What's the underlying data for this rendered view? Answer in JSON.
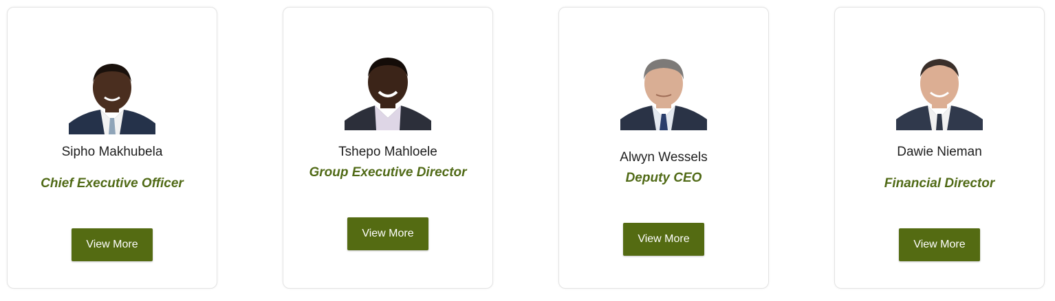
{
  "team": [
    {
      "name": "Sipho Makhubela",
      "role": "Chief Executive Officer",
      "button_label": "View More",
      "skin": "#4a2e1f",
      "suit": "#25324a",
      "shirt": "#f2f2f2",
      "tie": "#8fa4b8"
    },
    {
      "name": "Tshepo Mahloele",
      "role": "Group Executive Director",
      "button_label": "View More",
      "skin": "#3b2418",
      "suit": "#2c2f3a",
      "shirt": "#ded6e6",
      "tie": "#ded6e6"
    },
    {
      "name": "Alwyn Wessels",
      "role": "Deputy CEO",
      "button_label": "View More",
      "skin": "#d9ae94",
      "suit": "#2a3346",
      "shirt": "#e4e9f0",
      "tie": "#2a3e6b"
    },
    {
      "name": "Dawie Nieman",
      "role": "Financial Director",
      "button_label": "View More",
      "skin": "#dcae93",
      "suit": "#30394c",
      "shirt": "#f1f1f1",
      "tie": "#303848"
    }
  ],
  "colors": {
    "accent": "#506a16",
    "button_bg": "#546b12",
    "button_text": "#ffffff",
    "card_border": "#e3e3e3"
  }
}
